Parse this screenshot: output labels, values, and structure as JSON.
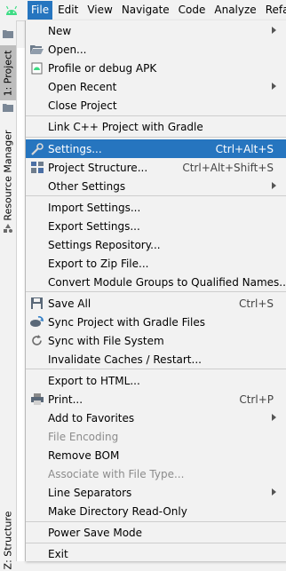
{
  "menubar": {
    "items": [
      {
        "label": "File"
      },
      {
        "label": "Edit"
      },
      {
        "label": "View"
      },
      {
        "label": "Navigate"
      },
      {
        "label": "Code"
      },
      {
        "label": "Analyze"
      },
      {
        "label": "Refac"
      }
    ]
  },
  "left_strip": {
    "project_tab": "1: Project",
    "resource_tab": "Resource Manager",
    "structure_tab": "Z: Structure"
  },
  "file_menu": {
    "new": "New",
    "open": "Open...",
    "profile_apk": "Profile or debug APK",
    "open_recent": "Open Recent",
    "close_project": "Close Project",
    "link_cpp": "Link C++ Project with Gradle",
    "settings": "Settings...",
    "settings_shortcut": "Ctrl+Alt+S",
    "project_structure": "Project Structure...",
    "project_structure_shortcut": "Ctrl+Alt+Shift+S",
    "other_settings": "Other Settings",
    "import_settings": "Import Settings...",
    "export_settings": "Export Settings...",
    "settings_repository": "Settings Repository...",
    "export_zip": "Export to Zip File...",
    "convert_module": "Convert Module Groups to Qualified Names...",
    "save_all": "Save All",
    "save_all_shortcut": "Ctrl+S",
    "sync_gradle": "Sync Project with Gradle Files",
    "sync_fs": "Sync with File System",
    "invalidate": "Invalidate Caches / Restart...",
    "export_html": "Export to HTML...",
    "print": "Print...",
    "print_shortcut": "Ctrl+P",
    "add_favorites": "Add to Favorites",
    "file_encoding": "File Encoding",
    "remove_bom": "Remove BOM",
    "associate_type": "Associate with File Type...",
    "line_separators": "Line Separators",
    "make_readonly": "Make Directory Read-Only",
    "power_save": "Power Save Mode",
    "exit": "Exit"
  },
  "colors": {
    "highlight": "#2675bf",
    "menu_bg": "#f2f2f2",
    "disabled_text": "#8c8c8c",
    "android_green": "#3ddc84"
  }
}
